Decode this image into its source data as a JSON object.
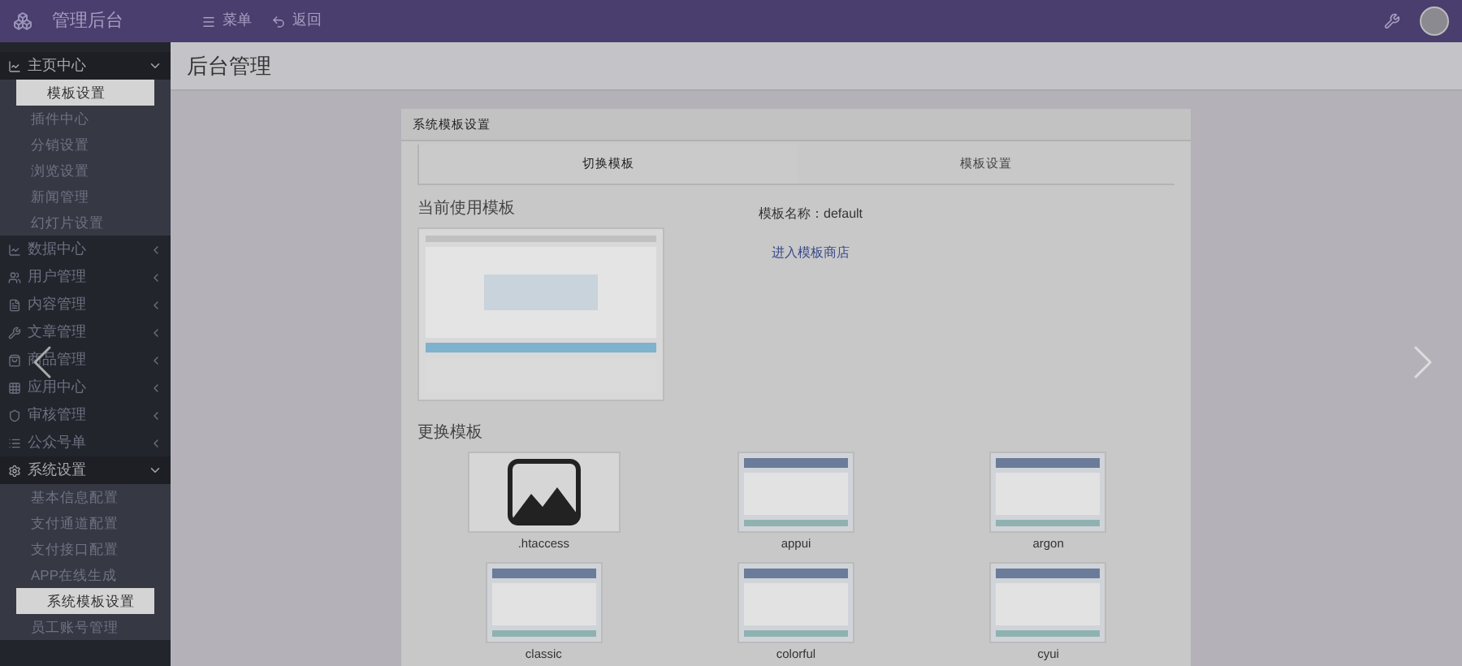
{
  "topbar": {
    "title": "管理后台",
    "menu": "菜单",
    "back": "返回"
  },
  "sidebar": {
    "groups": [
      {
        "label": "主页中心",
        "expanded": true,
        "children": [
          {
            "label": "模板设置",
            "selected": true
          },
          {
            "label": "插件中心",
            "selected": false
          },
          {
            "label": "分销设置",
            "selected": false
          },
          {
            "label": "浏览设置",
            "selected": false
          },
          {
            "label": "新闻管理",
            "selected": false
          },
          {
            "label": "幻灯片设置",
            "selected": false
          }
        ]
      },
      {
        "label": "数据中心",
        "expanded": false
      },
      {
        "label": "用户管理",
        "expanded": false
      },
      {
        "label": "内容管理",
        "expanded": false
      },
      {
        "label": "文章管理",
        "expanded": false
      },
      {
        "label": "商品管理",
        "expanded": false
      },
      {
        "label": "应用中心",
        "expanded": false
      },
      {
        "label": "审核管理",
        "expanded": false
      },
      {
        "label": "公众号单",
        "expanded": false
      },
      {
        "label": "系统设置",
        "expanded": true,
        "children": [
          {
            "label": "基本信息配置",
            "selected": false
          },
          {
            "label": "支付通道配置",
            "selected": false
          },
          {
            "label": "支付接口配置",
            "selected": false
          },
          {
            "label": "APP在线生成",
            "selected": false
          },
          {
            "label": "系统模板设置",
            "selected": true
          },
          {
            "label": "员工账号管理",
            "selected": false
          }
        ]
      }
    ]
  },
  "page": {
    "title": "后台管理"
  },
  "modal": {
    "title": "系统模板设置",
    "tabs": [
      {
        "label": "切换模板",
        "selected": true
      },
      {
        "label": "模板设置",
        "selected": false
      }
    ],
    "current": {
      "heading": "当前使用模板",
      "name_label": "模板名称：",
      "name_value": "default",
      "link": "进入模板商店"
    },
    "templates_heading": "更换模板",
    "templates": [
      {
        "name": ".htaccess",
        "kind": "empty"
      },
      {
        "name": "appui",
        "kind": "preview"
      },
      {
        "name": "argon",
        "kind": "preview"
      },
      {
        "name": "classic",
        "kind": "preview"
      },
      {
        "name": "colorful",
        "kind": "preview"
      },
      {
        "name": "cyui",
        "kind": "preview"
      }
    ]
  }
}
